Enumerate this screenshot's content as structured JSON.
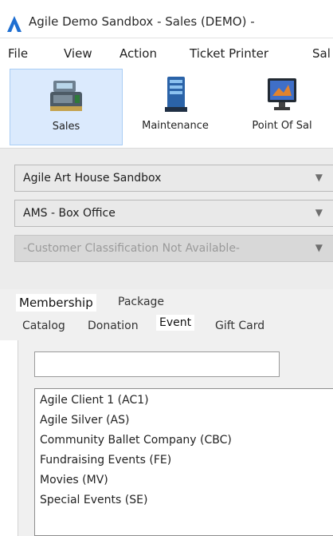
{
  "window": {
    "title": "Agile Demo Sandbox - Sales (DEMO) -",
    "icon": "agile-a-logo-icon",
    "accent_color": "#1f6fd1"
  },
  "menu": {
    "items": [
      "File",
      "View",
      "Action",
      "Ticket Printer",
      "Sal"
    ]
  },
  "toolbar": {
    "buttons": [
      {
        "label": "Sales",
        "icon": "cash-register-icon",
        "selected": true
      },
      {
        "label": "Maintenance",
        "icon": "server-icon",
        "selected": false
      },
      {
        "label": "Point Of Sal",
        "icon": "monitor-icon",
        "selected": false
      }
    ]
  },
  "selectors": {
    "organization": "Agile Art House Sandbox",
    "location": "AMS - Box Office",
    "classification": "-Customer Classification Not Available-"
  },
  "tabs": {
    "row1": [
      "Membership",
      "Package"
    ],
    "row2": [
      "Catalog",
      "Donation",
      "Event",
      "Gift Card"
    ],
    "active": "Event",
    "highlighted": "Membership"
  },
  "search": {
    "value": ""
  },
  "organizations": [
    "Agile Client 1  (AC1)",
    "Agile Silver  (AS)",
    "Community Ballet Company  (CBC)",
    "Fundraising Events  (FE)",
    "Movies  (MV)",
    "Special Events  (SE)"
  ]
}
